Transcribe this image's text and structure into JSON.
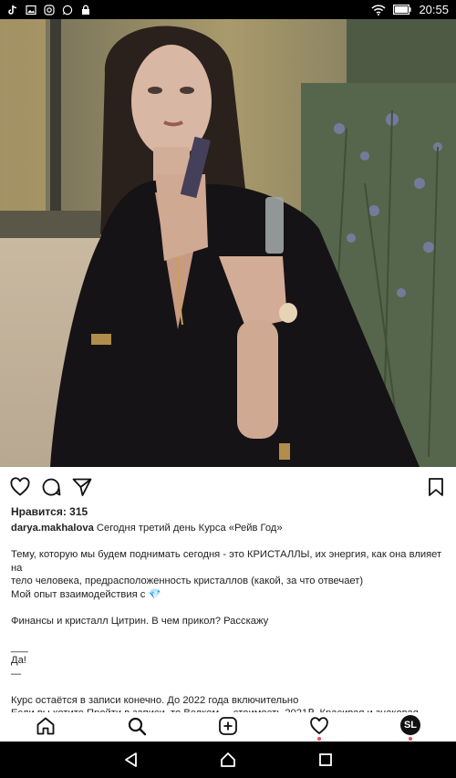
{
  "status_bar": {
    "time": "20:55",
    "left_icons": [
      "tiktok-icon",
      "image-icon",
      "instagram-icon",
      "whatsapp-icon",
      "lock-icon"
    ],
    "right_icons": [
      "wifi-icon",
      "battery-icon"
    ]
  },
  "post": {
    "likes_text": "Нравится: 315",
    "username": "darya.makhalova",
    "caption_first": " Сегодня третий день Курса «Рейв Год»",
    "lines": [
      "Тему, которую мы будем поднимать сегодня - это КРИСТАЛЛЫ, их энергия, как она влияет на",
      "тело человека, предрасположенность кристаллов (какой, за что отвечает)",
      "Мой опыт взаимодействия с 💎",
      "",
      "Финансы и кристалл Цитрин. В чем прикол? Расскажу",
      "",
      "___",
      "Да!",
      "—",
      "",
      "Курс остаётся в записи  конечно. До 2022 года включительно",
      "Если вы хотите Пройти в записи, то Велком ... стоимость 2021₽. Красивая и знаковая цифра"
    ]
  },
  "bottom_nav": {
    "avatar_initials": "SL",
    "accent_dot_color": "#ed4956"
  }
}
